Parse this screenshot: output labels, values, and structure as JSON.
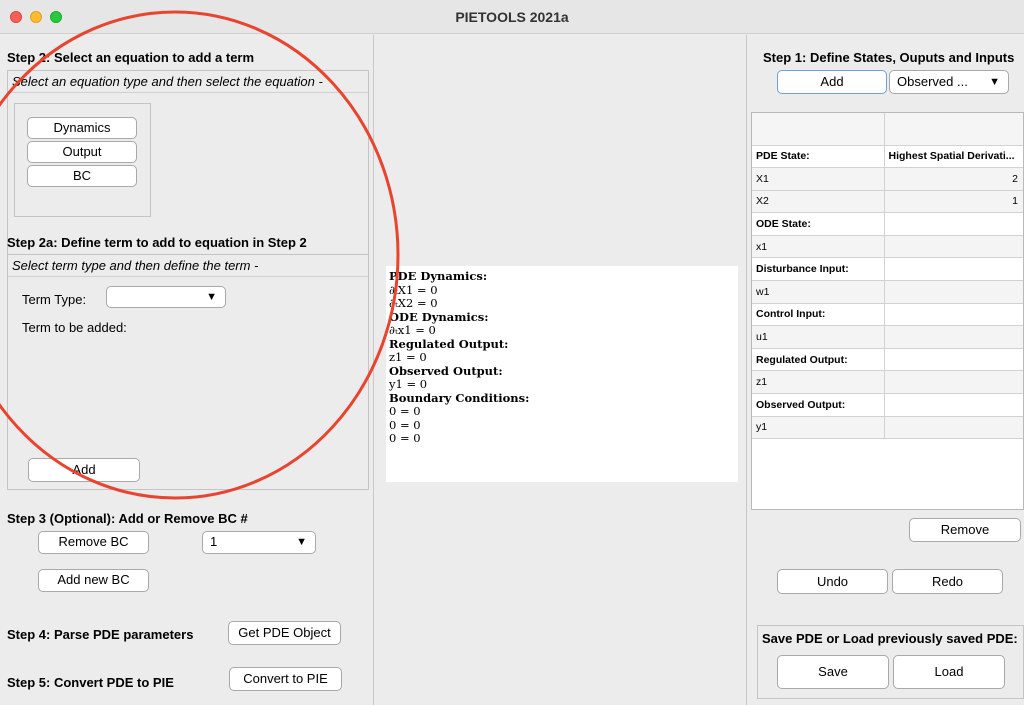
{
  "window": {
    "title": "PIETOOLS 2021a"
  },
  "left": {
    "step2_heading": "Step 2: Select an equation to add a term",
    "step2_group_title": "Select an equation type and then select the equation -",
    "eq_buttons": [
      "Dynamics",
      "Output",
      "BC"
    ],
    "step2a_heading": "Step 2a: Define term to add to equation in Step 2",
    "step2a_group_title": "Select term type and then define the term -",
    "term_type_label": "Term Type:",
    "term_type_value": "",
    "term_added_label": "Term to be added:",
    "add_label": "Add",
    "step3_heading": "Step 3 (Optional): Add or Remove BC #",
    "remove_bc_label": "Remove BC",
    "bc_select_value": "1",
    "add_new_bc_label": "Add new BC",
    "step4_heading": "Step 4: Parse PDE parameters",
    "get_pde_label": "Get PDE Object",
    "step5_heading": "Step 5: Convert PDE to PIE",
    "convert_label": "Convert to PIE"
  },
  "middle": {
    "equations": [
      {
        "kind": "head",
        "text": "PDE Dynamics:"
      },
      {
        "kind": "eq",
        "text": "∂ₜX1 = 0"
      },
      {
        "kind": "eq",
        "text": "∂ₜX2 = 0"
      },
      {
        "kind": "head",
        "text": "ODE Dynamics:"
      },
      {
        "kind": "eq",
        "text": "∂ₜx1 = 0"
      },
      {
        "kind": "head",
        "text": "Regulated Output:"
      },
      {
        "kind": "eq",
        "text": "z1 = 0"
      },
      {
        "kind": "head",
        "text": "Observed Output:"
      },
      {
        "kind": "eq",
        "text": "y1 = 0"
      },
      {
        "kind": "head",
        "text": "Boundary Conditions:"
      },
      {
        "kind": "eq",
        "text": "0 = 0"
      },
      {
        "kind": "eq",
        "text": "0 = 0"
      },
      {
        "kind": "eq",
        "text": "0 = 0"
      }
    ]
  },
  "right": {
    "step1_heading": "Step 1: Define States, Ouputs and Inputs",
    "add_label": "Add",
    "type_select_value": "Observed ...",
    "table_rows": [
      {
        "kind": "cat",
        "c1": "PDE State:",
        "c2": "Highest Spatial Derivati..."
      },
      {
        "kind": "item",
        "c1": "X1",
        "c2": "2"
      },
      {
        "kind": "item",
        "c1": "X2",
        "c2": "1"
      },
      {
        "kind": "cat",
        "c1": "ODE State:",
        "c2": ""
      },
      {
        "kind": "item",
        "c1": "x1",
        "c2": ""
      },
      {
        "kind": "cat",
        "c1": "Disturbance Input:",
        "c2": ""
      },
      {
        "kind": "item",
        "c1": "w1",
        "c2": ""
      },
      {
        "kind": "cat",
        "c1": "Control Input:",
        "c2": ""
      },
      {
        "kind": "item",
        "c1": "u1",
        "c2": ""
      },
      {
        "kind": "cat",
        "c1": "Regulated Output:",
        "c2": ""
      },
      {
        "kind": "item",
        "c1": "z1",
        "c2": ""
      },
      {
        "kind": "cat",
        "c1": "Observed Output:",
        "c2": ""
      },
      {
        "kind": "item",
        "c1": "y1",
        "c2": ""
      }
    ],
    "remove_label": "Remove",
    "undo_label": "Undo",
    "redo_label": "Redo",
    "save_load_heading": "Save PDE or Load previously saved PDE:",
    "save_label": "Save",
    "load_label": "Load"
  },
  "colors": {
    "annotation_circle": "#e8442f"
  }
}
